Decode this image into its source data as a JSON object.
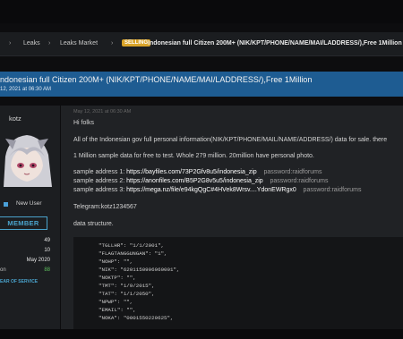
{
  "breadcrumb": {
    "items": [
      "Leaks",
      "Leaks Market"
    ],
    "badge": "SELLING",
    "thread_title": "Indonesian full Citizen 200M+ (NIK/KPT/PHONE/NAME/MAI/LADDRESS/),Free 1Million"
  },
  "thread": {
    "title": "ndonesian full Citizen 200M+ (NIK/KPT/PHONE/NAME/MAI/LADDRESS/),Free 1Million",
    "date": "12, 2021 at 06:30 AM"
  },
  "user": {
    "name": "kotz",
    "role": "New User",
    "rank": "MEMBER",
    "stats": [
      {
        "key": "",
        "value": "49"
      },
      {
        "key": "",
        "value": "10"
      },
      {
        "key": "",
        "value": "May 2020"
      },
      {
        "key": "on",
        "value": "88"
      }
    ],
    "year_of_service": "EAR OF SERVICE"
  },
  "post": {
    "date": "May 12, 2021 at 06:30 AM",
    "greeting": "Hi folks",
    "intro": "All of the Indonesian gov full personal information(NIK/KPT/PHONE/MAIL/NAME/ADDRESS/) data for sale. there",
    "sample_note": "1 Million sample data for free to test. Whole 279 million. 20million have personal photo.",
    "samples": [
      {
        "label": "sample address 1: ",
        "url": "https://bayfiles.com/73P2Gfv8u5/indonesia_zip",
        "pw": "password:raidforums"
      },
      {
        "label": "sample address 2: ",
        "url": "https://anonfiles.com/B5P2G8v5u5/indonesia_zip",
        "pw": "password:raidforums"
      },
      {
        "label": "sample address 3: ",
        "url": "https://mega.nz/file/e94kgQgC#4HVek8Wrsv....YdonEWRgx0",
        "pw": "password:raidforums"
      }
    ],
    "telegram": "Telegram:kotz1234567",
    "structure_label": "data structure.",
    "code_lines": [
      "\"TGLLHR\": \"1/1/2001\",",
      "\"FLAGTANGGUNGAN\": \"1\",",
      "\"NOHP\": \"\",",
      "\"NIK\": \"6201150906060001\",",
      "\"NOKTP\": \"\",",
      "\"TMT\": \"1/9/2015\",",
      "\"TAT\": \"1/1/2050\",",
      "\"NPWP\": \"\",",
      "\"EMAIL\": \"\",",
      "\"NOKA\": \"0001550220625\","
    ]
  },
  "colors": {
    "title_bar": "#1e5c92",
    "badge": "#d9a329",
    "accent": "#4aa3cc"
  }
}
